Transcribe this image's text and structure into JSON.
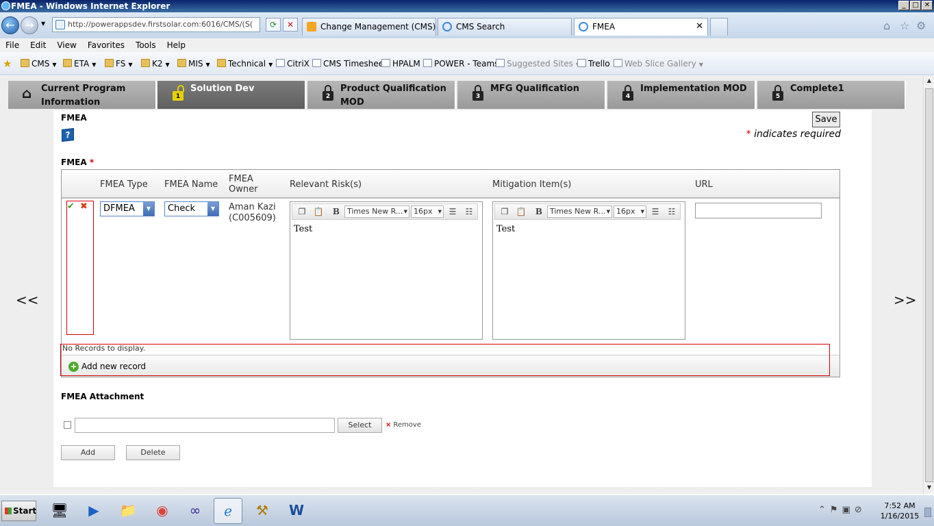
{
  "window": {
    "title": "FMEA - Windows Internet Explorer",
    "min": "_",
    "max": "□",
    "close": "✕"
  },
  "browser": {
    "back": "←",
    "forward": "→",
    "address": "http://powerappsdev.firstsolar.com:6016/CMS/(S(",
    "refresh": "⟳",
    "stop": "✕",
    "tabs": [
      {
        "label": "Change Management (CMS) - H..."
      },
      {
        "label": "CMS Search"
      },
      {
        "label": "FMEA"
      }
    ],
    "tab_close": "✕"
  },
  "menu": [
    "File",
    "Edit",
    "View",
    "Favorites",
    "Tools",
    "Help"
  ],
  "favorites": [
    {
      "label": "CMS",
      "dropdown": true
    },
    {
      "label": "ETA",
      "dropdown": true
    },
    {
      "label": "FS",
      "dropdown": true
    },
    {
      "label": "K2",
      "dropdown": true
    },
    {
      "label": "MIS",
      "dropdown": true
    },
    {
      "label": "Technical",
      "dropdown": true
    },
    {
      "label": "CitriX",
      "dropdown": false
    },
    {
      "label": "CMS Timesheet",
      "dropdown": false
    },
    {
      "label": "HPALM",
      "dropdown": false
    },
    {
      "label": "POWER - Teams",
      "dropdown": false
    },
    {
      "label": "Suggested Sites",
      "dropdown": true
    },
    {
      "label": "Trello",
      "dropdown": false
    },
    {
      "label": "Web Slice Gallery",
      "dropdown": true
    }
  ],
  "steps": [
    {
      "label": "Current Program Information",
      "num": ""
    },
    {
      "label": "Solution Dev",
      "num": "1"
    },
    {
      "label": "Product Qualification MOD",
      "num": "2"
    },
    {
      "label": "MFG Qualification",
      "num": "3"
    },
    {
      "label": "Implementation MOD",
      "num": "4"
    },
    {
      "label": "Complete1",
      "num": "5"
    }
  ],
  "page": {
    "section_title": "FMEA",
    "help": "?",
    "save": "Save",
    "required_star": "*",
    "required_text": "indicates required",
    "prev": "<<",
    "next": ">>"
  },
  "grid": {
    "label": "FMEA",
    "label_star": "*",
    "columns": [
      "FMEA Type",
      "FMEA Name",
      "FMEA Owner",
      "Relevant Risk(s)",
      "Mitigation Item(s)",
      "URL"
    ],
    "row": {
      "confirm": "✔",
      "cancel": "✖",
      "type": "DFMEA",
      "name": "Check",
      "owner_line1": "Aman Kazi",
      "owner_line2": "(C005609)",
      "risk_font": "Times New R...",
      "risk_size": "16px",
      "risk_text": "Test",
      "mitigation_font": "Times New R...",
      "mitigation_size": "16px",
      "mitigation_text": "Test",
      "url": ""
    },
    "no_records": "No Records to display.",
    "add_new": "Add new record",
    "add_plus": "+"
  },
  "attachment": {
    "title": "FMEA Attachment",
    "select": "Select",
    "remove_x": "×",
    "remove": "Remove",
    "add": "Add",
    "delete": "Delete"
  },
  "taskbar": {
    "start": "Start",
    "time": "7:52 AM",
    "date": "1/16/2015"
  }
}
